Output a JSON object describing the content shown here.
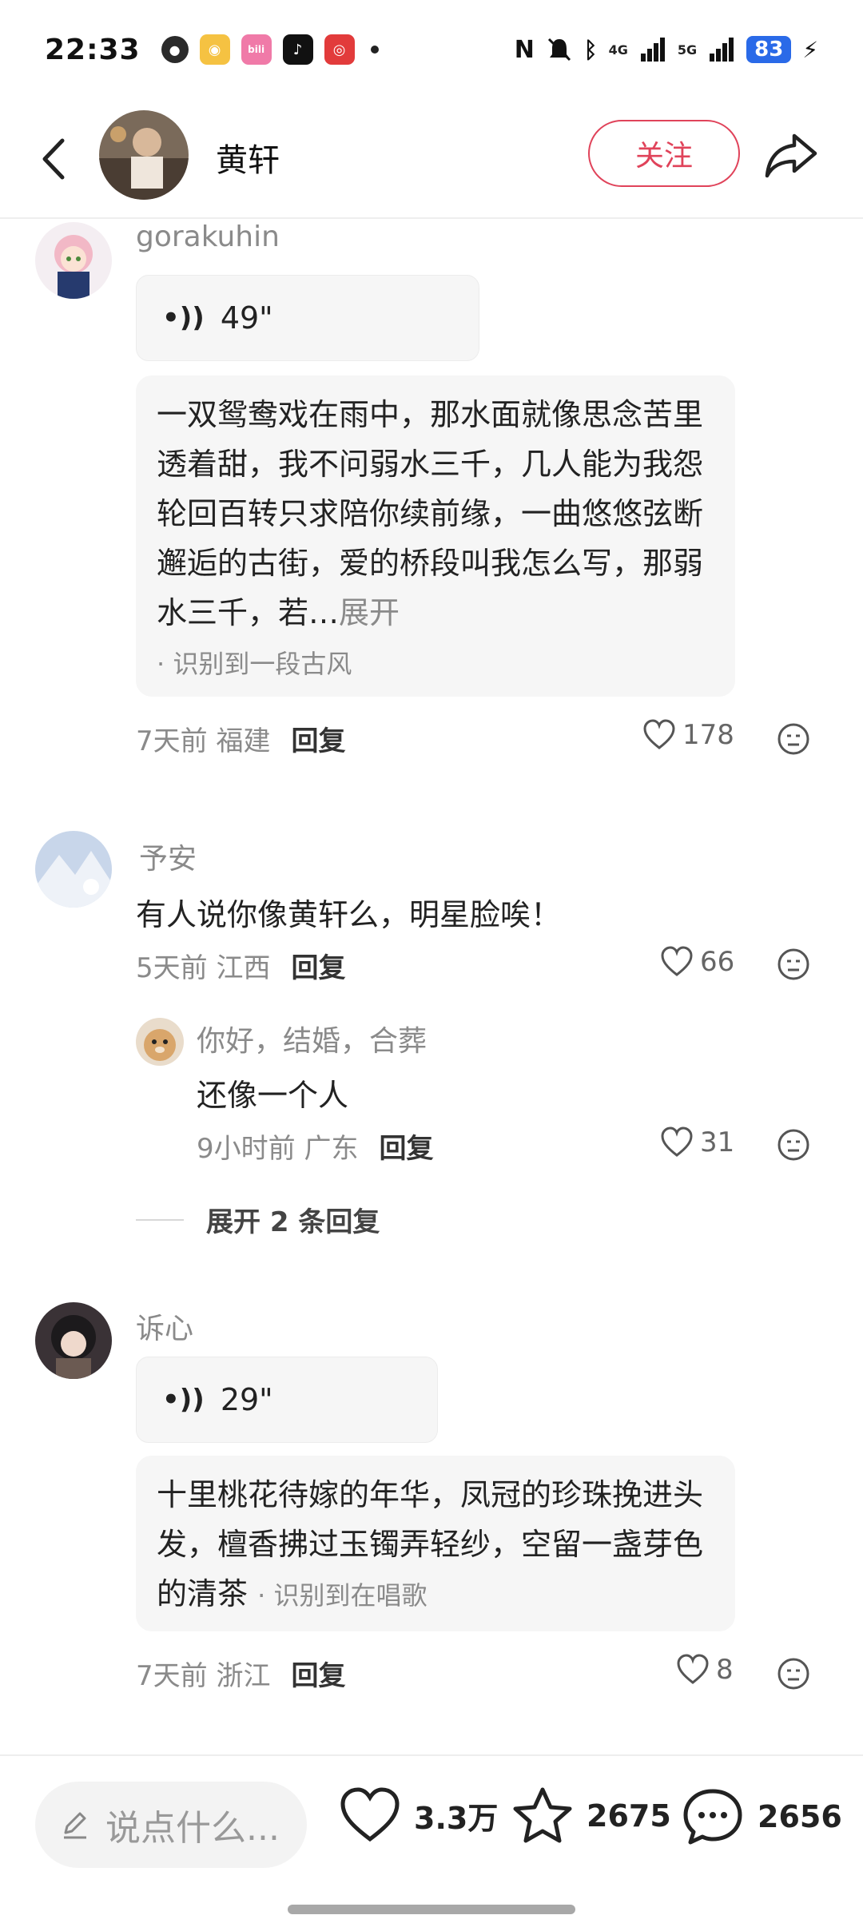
{
  "status_bar": {
    "time": "22:33",
    "battery": "83",
    "network_4g": "4G",
    "network_5g": "5G"
  },
  "header": {
    "name": "黄轩",
    "follow_label": "关注"
  },
  "comments": [
    {
      "user": "gorakuhin",
      "voice_duration": "49\"",
      "lyric_text": "一双鸳鸯戏在雨中，那水面就像思念苦里透着甜，我不问弱水三千，几人能为我怨轮回百转只求陪你续前缘，一曲悠悠弦断邂逅的古街，爱的桥段叫我怎么写，那弱水三千，若…",
      "lyric_more": "展开",
      "lyric_tag": "· 识别到一段古风",
      "time": "7天前",
      "location": "福建",
      "reply_label": "回复",
      "likes": "178"
    },
    {
      "user": "予安",
      "text": "有人说你像黄轩么，明星脸唉！",
      "time": "5天前",
      "location": "江西",
      "reply_label": "回复",
      "likes": "66",
      "sub_reply": {
        "user": "你好，结婚，合葬",
        "text": "还像一个人",
        "time": "9小时前",
        "location": "广东",
        "reply_label": "回复",
        "likes": "31"
      },
      "expand_label": "展开 2 条回复"
    },
    {
      "user": "诉心",
      "voice_duration": "29\"",
      "lyric_text": "十里桃花待嫁的年华，凤冠的珍珠挽进头发，檀香拂过玉镯弄轻纱，空留一盏芽色的清茶",
      "lyric_tag": "· 识别到在唱歌",
      "time": "7天前",
      "location": "浙江",
      "reply_label": "回复",
      "likes": "8"
    }
  ],
  "bottom_bar": {
    "input_placeholder": "说点什么...",
    "likes": "3.3万",
    "favorites": "2675",
    "comments": "2656"
  },
  "colors": {
    "accent": "#e0435a",
    "muted_text": "#8a8a8a",
    "bubble_bg": "#f6f6f6"
  }
}
